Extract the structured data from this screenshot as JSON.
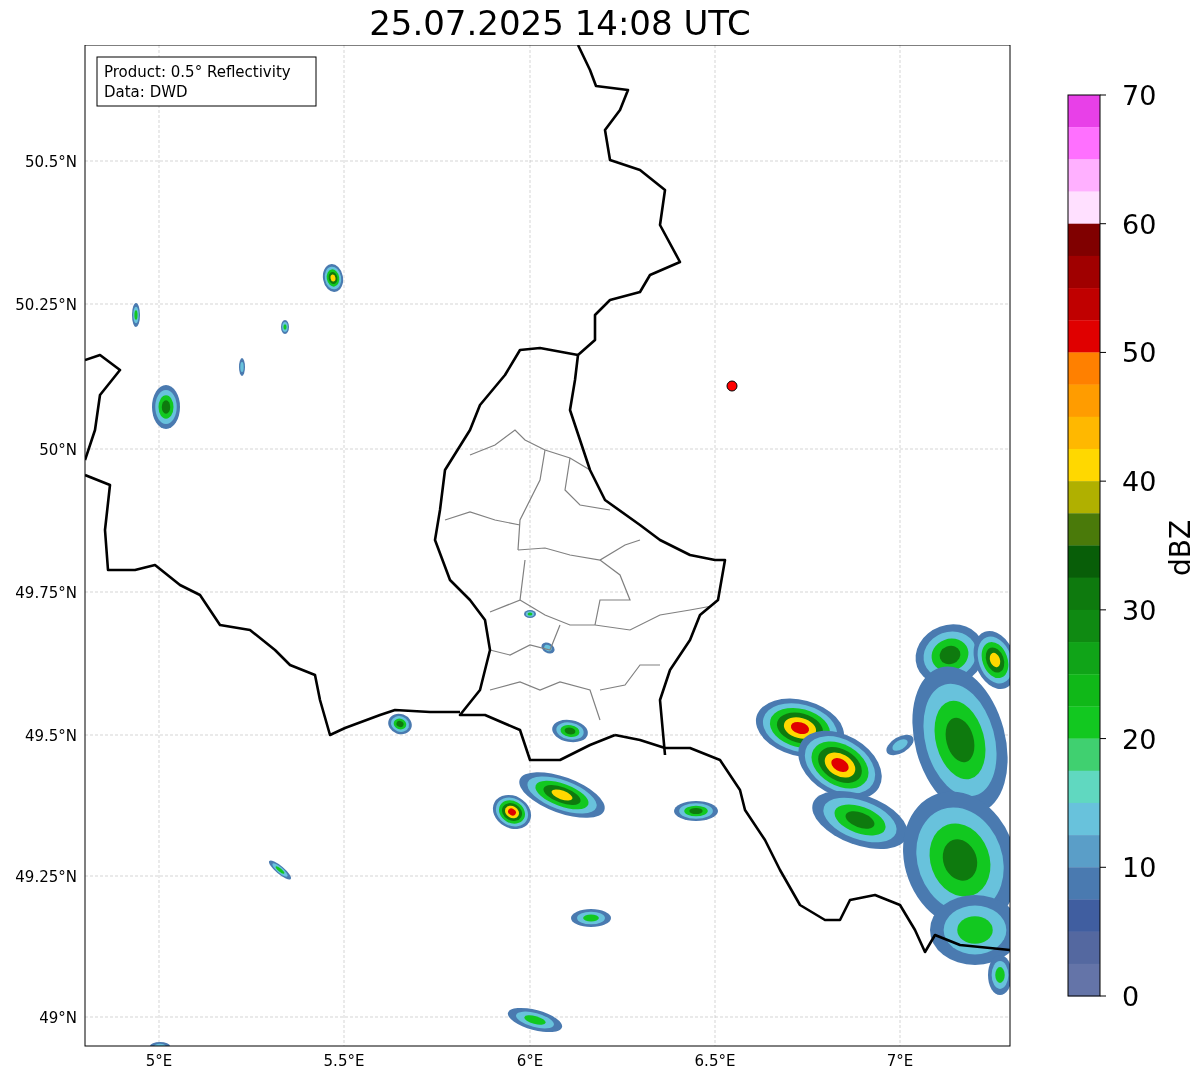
{
  "title": "25.07.2025 14:08 UTC",
  "info_box": [
    "Product: 0.5° Reflectivity",
    "Data: DWD"
  ],
  "lat_ticks": [
    "50.5°N",
    "50.25°N",
    "50°N",
    "49.75°N",
    "49.5°N",
    "49.25°N",
    "49°N"
  ],
  "lon_ticks": [
    "5°E",
    "5.5°E",
    "6°E",
    "6.5°E",
    "7°E"
  ],
  "colorbar": {
    "label": "dBZ",
    "ticks": [
      "70",
      "60",
      "50",
      "40",
      "30",
      "20",
      "10",
      "0"
    ],
    "bins": [
      {
        "color": "#e840e8"
      },
      {
        "color": "#ff70ff"
      },
      {
        "color": "#ffb0ff"
      },
      {
        "color": "#ffe0ff"
      },
      {
        "color": "#800000"
      },
      {
        "color": "#a00000"
      },
      {
        "color": "#c00000"
      },
      {
        "color": "#e00000"
      },
      {
        "color": "#ff8000"
      },
      {
        "color": "#ff9c00"
      },
      {
        "color": "#ffb800"
      },
      {
        "color": "#ffd800"
      },
      {
        "color": "#b0b000"
      },
      {
        "color": "#4a7a0a"
      },
      {
        "color": "#085e08"
      },
      {
        "color": "#0e7a0e"
      },
      {
        "color": "#0f8a12"
      },
      {
        "color": "#10a418"
      },
      {
        "color": "#10b818"
      },
      {
        "color": "#12c820"
      },
      {
        "color": "#40d070"
      },
      {
        "color": "#60d8c0"
      },
      {
        "color": "#68c2dc"
      },
      {
        "color": "#5a9ec8"
      },
      {
        "color": "#4a7ab0"
      },
      {
        "color": "#405ea0"
      },
      {
        "color": "#5468a0"
      },
      {
        "color": "#6474a8"
      }
    ]
  }
}
